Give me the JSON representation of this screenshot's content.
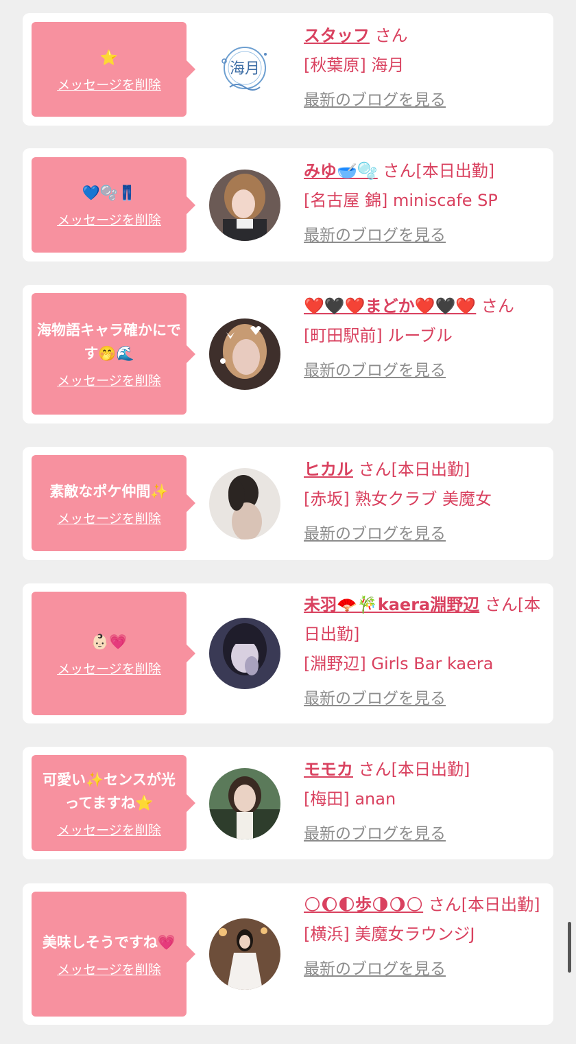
{
  "delete_label": "メッセージを削除",
  "blog_label": "最新のブログを見る",
  "colors": {
    "background": "#efefef",
    "card": "#ffffff",
    "bubble": "#f7919f",
    "accent": "#d9415f",
    "link_gray": "#8c8c8c"
  },
  "messages": [
    {
      "message": "⭐",
      "name": "スタッフ",
      "suffix": " さん",
      "shop": "[秋葉原] 海月"
    },
    {
      "message": "💙🫧👖",
      "name": "みゆ🥣🫧",
      "suffix": " さん[本日出勤]",
      "shop": "[名古屋 錦] miniscafe SP"
    },
    {
      "message": "海物語キャラ確かにです🤭🌊",
      "name": "❤️🖤❤️まどか❤️🖤❤️",
      "suffix": " さん",
      "shop": "[町田駅前] ルーブル"
    },
    {
      "message": "素敵なポケ仲間✨",
      "name": "ヒカル",
      "suffix": " さん[本日出勤]",
      "shop": "[赤坂] 熟女クラブ 美魔女"
    },
    {
      "message": "👶🏻💗",
      "name": "未羽🪭🎋kaera淵野辺",
      "suffix": " さん[本日出勤]",
      "shop": "[淵野辺] Girls Bar kaera"
    },
    {
      "message": "可愛い✨センスが光ってますね⭐",
      "name": "モモカ",
      "suffix": " さん[本日出勤]",
      "shop": "[梅田] anan"
    },
    {
      "message": "美味しそうですね💗",
      "name": "🌕🌔🌓歩🌗🌖🌕",
      "suffix": " さん[本日出勤]",
      "shop": "[横浜] 美魔女ラウンジJ"
    }
  ]
}
